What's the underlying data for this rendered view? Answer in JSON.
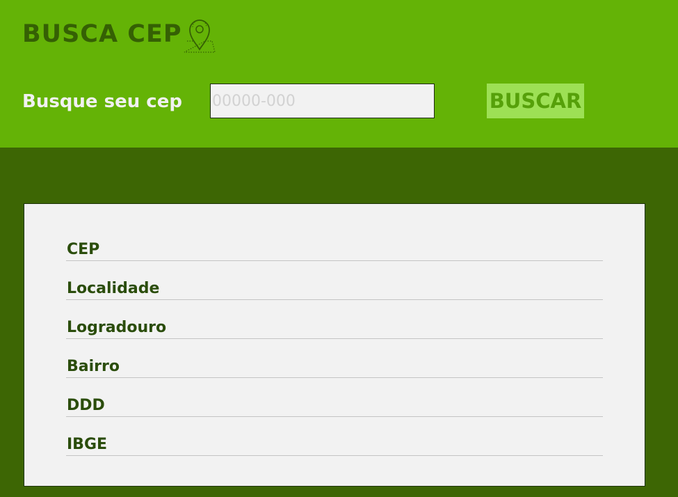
{
  "header": {
    "title": "BUSCA CEP",
    "icon": "location-pin-icon"
  },
  "search": {
    "label": "Busque seu cep",
    "placeholder": "00000-000",
    "value": "",
    "button_label": "BUSCAR"
  },
  "result": {
    "fields": [
      {
        "label": "CEP"
      },
      {
        "label": "Localidade"
      },
      {
        "label": "Logradouro"
      },
      {
        "label": "Bairro"
      },
      {
        "label": "DDD"
      },
      {
        "label": "IBGE"
      }
    ]
  },
  "colors": {
    "header_bg": "#64b306",
    "page_bg": "#3d6604",
    "title": "#356004",
    "button_bg": "#9de055",
    "button_text": "#56a00a",
    "card_bg": "#f2f2f2",
    "field_text": "#2b4d0c"
  }
}
